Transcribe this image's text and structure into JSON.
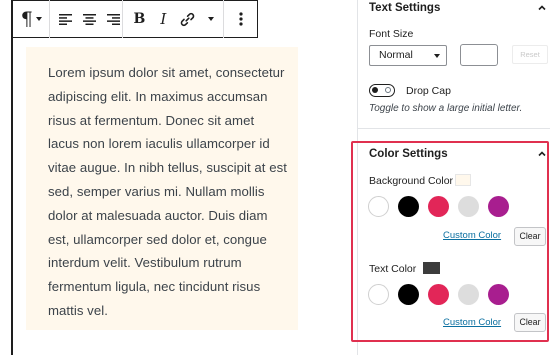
{
  "editor": {
    "toolbar": {
      "paragraph_icon": "¶",
      "bold_icon": "B",
      "italic_icon": "I"
    },
    "paragraph_text": "Lorem ipsum dolor sit amet, consectetur adipiscing elit. In maximus accumsan risus at fermentum. Donec sit amet lacus non lorem iaculis ullamcorper id vitae augue. In nibh tellus, suscipit at est sed, semper varius mi. Nullam mollis dolor at malesuada auctor. Duis diam est, ullamcorper sed dolor et, congue interdum velit. Vestibulum rutrum fermentum ligula, nec tincidunt risus mattis vel.",
    "paragraph_background": "#fff8ec"
  },
  "sidebar": {
    "text_settings": {
      "title": "Text Settings",
      "font_size_label": "Font Size",
      "font_size_value": "Normal",
      "custom_size_value": "",
      "reset_label": "Reset",
      "drop_cap_label": "Drop Cap",
      "drop_cap_help": "Toggle to show a large initial letter."
    },
    "color_settings": {
      "title": "Color Settings",
      "background": {
        "label": "Background Color",
        "current": "#fff8ec",
        "custom_link": "Custom Color",
        "clear_label": "Clear"
      },
      "text": {
        "label": "Text Color",
        "current": "#3c3c3c",
        "custom_link": "Custom Color",
        "clear_label": "Clear"
      },
      "palette": [
        "#ffffff",
        "#000000",
        "#e22658",
        "#dddddd",
        "#a81e8f"
      ]
    }
  }
}
